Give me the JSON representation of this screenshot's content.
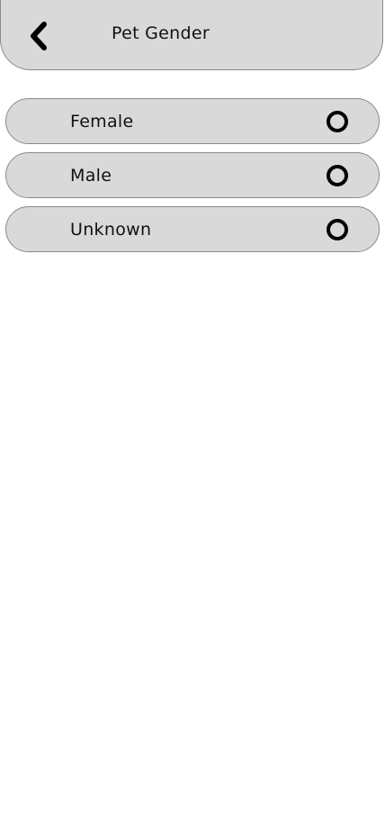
{
  "header": {
    "title": "Pet Gender",
    "back_icon": "chevron-left-icon"
  },
  "options": [
    {
      "label": "Female",
      "selected": false
    },
    {
      "label": "Male",
      "selected": false
    },
    {
      "label": "Unknown",
      "selected": false
    }
  ]
}
